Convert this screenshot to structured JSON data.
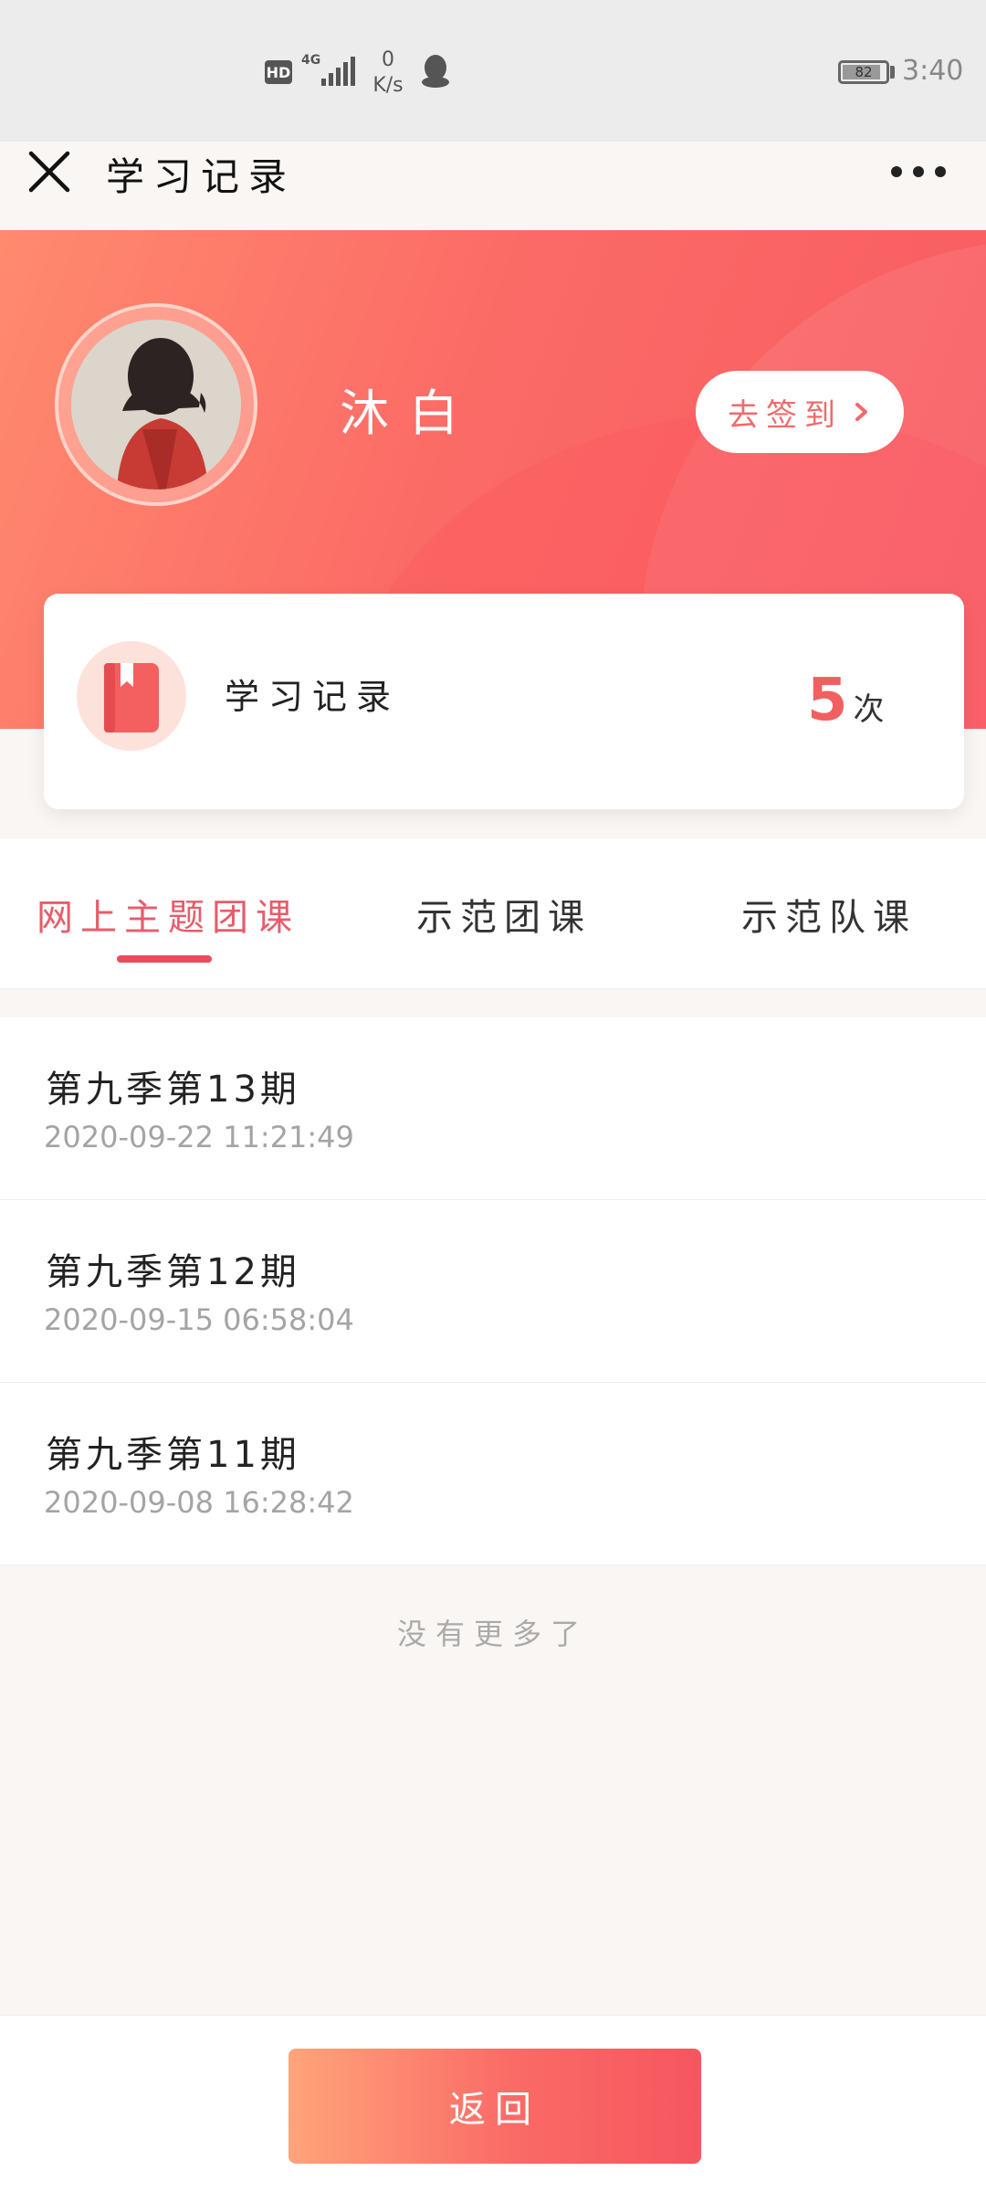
{
  "status_bar": {
    "hd": "HD",
    "network": "4G",
    "speed_value": "0",
    "speed_unit": "K/s",
    "battery": "82",
    "time": "3:40",
    "icons": [
      "hd-icon",
      "signal-icon",
      "qq-icon",
      "battery-icon"
    ]
  },
  "nav": {
    "title": "学习记录",
    "close_icon": "close-icon",
    "more_icon": "more-icon"
  },
  "profile": {
    "name": "沐白",
    "checkin_label": "去签到"
  },
  "stats": {
    "label": "学习记录",
    "count": "5",
    "unit": "次",
    "icon": "book-icon"
  },
  "tabs": [
    {
      "label": "网上主题团课",
      "active": true
    },
    {
      "label": "示范团课",
      "active": false
    },
    {
      "label": "示范队课",
      "active": false
    }
  ],
  "records": [
    {
      "title": "第九季第13期",
      "time": "2020-09-22 11:21:49"
    },
    {
      "title": "第九季第12期",
      "time": "2020-09-15 06:58:04"
    },
    {
      "title": "第九季第11期",
      "time": "2020-09-08 16:28:42"
    }
  ],
  "no_more": "没有更多了",
  "bottom": {
    "back_label": "返回"
  },
  "colors": {
    "accent": "#e84d5d",
    "banner_start": "#ff8a6e",
    "banner_end": "#f85a62"
  }
}
